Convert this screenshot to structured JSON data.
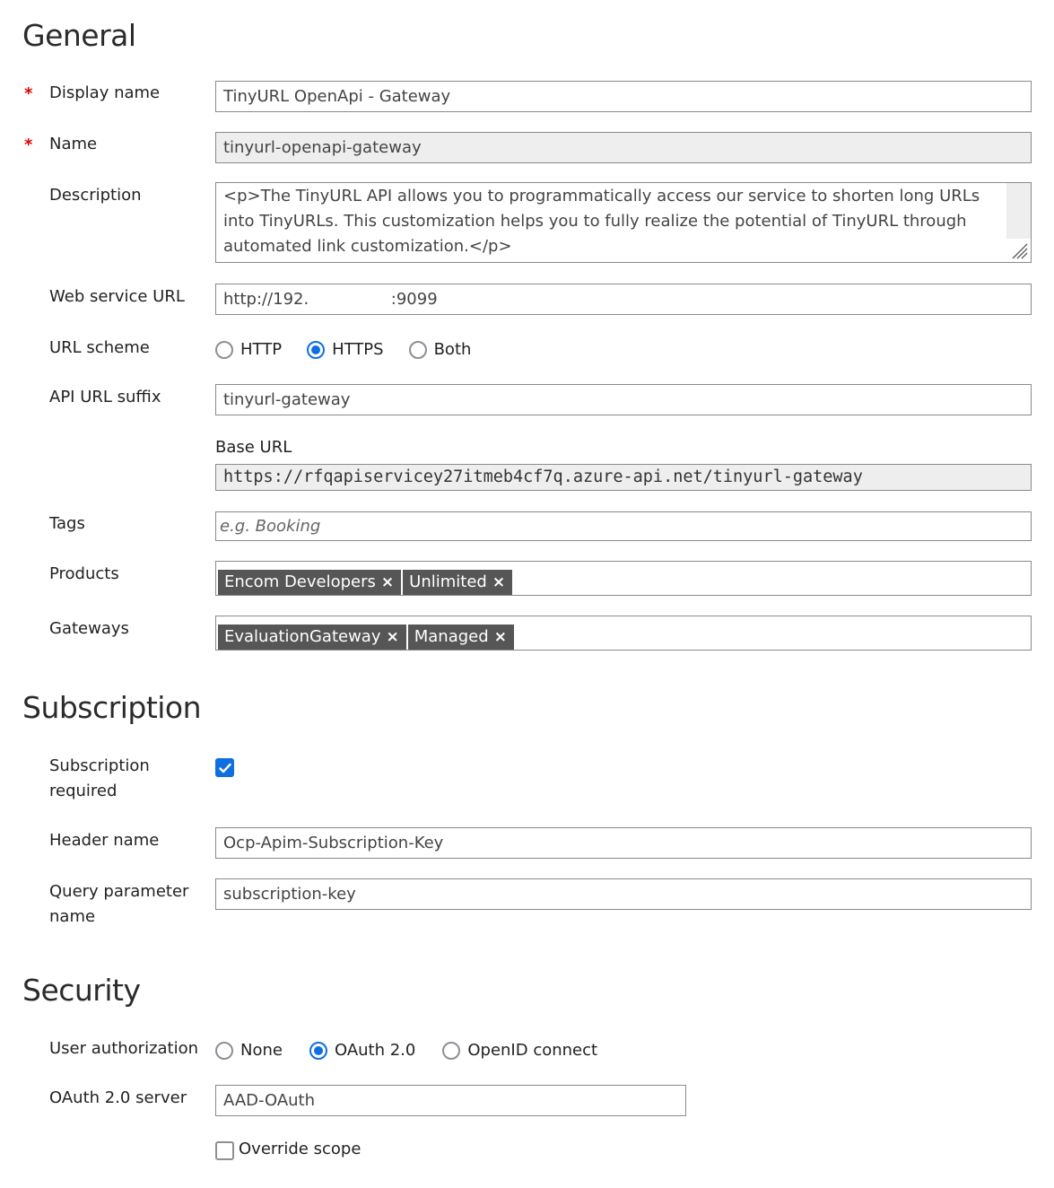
{
  "general": {
    "title": "General",
    "required_mark": "*",
    "display_name": {
      "label": "Display name",
      "value": "TinyURL OpenApi - Gateway",
      "required": true
    },
    "name": {
      "label": "Name",
      "value": "tinyurl-openapi-gateway",
      "required": true
    },
    "description": {
      "label": "Description",
      "value": "<p>The TinyURL API allows you to programmatically access our service to shorten long URLs into TinyURLs. This customization helps you to fully realize the potential of TinyURL through automated link customization.</p>"
    },
    "web_service_url": {
      "label": "Web service URL",
      "value": "http://192.                :9099"
    },
    "url_scheme": {
      "label": "URL scheme",
      "options": [
        {
          "label": "HTTP",
          "selected": false
        },
        {
          "label": "HTTPS",
          "selected": true
        },
        {
          "label": "Both",
          "selected": false
        }
      ]
    },
    "api_url_suffix": {
      "label": "API URL suffix",
      "value": "tinyurl-gateway"
    },
    "base_url": {
      "label": "Base URL",
      "value": "https://rfqapiservicey27itmeb4cf7q.azure-api.net/tinyurl-gateway"
    },
    "tags": {
      "label": "Tags",
      "placeholder": "e.g. Booking"
    },
    "products": {
      "label": "Products",
      "chips": [
        "Encom Developers",
        "Unlimited"
      ]
    },
    "gateways": {
      "label": "Gateways",
      "chips": [
        "EvaluationGateway",
        "Managed"
      ]
    },
    "chip_remove_glyph": "×"
  },
  "subscription": {
    "title": "Subscription",
    "required": {
      "label": "Subscription required",
      "checked": true
    },
    "header_name": {
      "label": "Header name",
      "value": "Ocp-Apim-Subscription-Key"
    },
    "query_param": {
      "label": "Query parameter name",
      "value": "subscription-key"
    }
  },
  "security": {
    "title": "Security",
    "user_authorization": {
      "label": "User authorization",
      "options": [
        {
          "label": "None",
          "selected": false
        },
        {
          "label": "OAuth 2.0",
          "selected": true
        },
        {
          "label": "OpenID connect",
          "selected": false
        }
      ]
    },
    "oauth_server": {
      "label": "OAuth 2.0 server",
      "value": "AAD-OAuth"
    },
    "override_scope": {
      "label": "Override scope",
      "checked": false
    }
  },
  "colors": {
    "accent": "#0f6fe0",
    "required": "#e00000",
    "chip_bg": "#565656",
    "readonly_bg": "#eeeeee"
  }
}
